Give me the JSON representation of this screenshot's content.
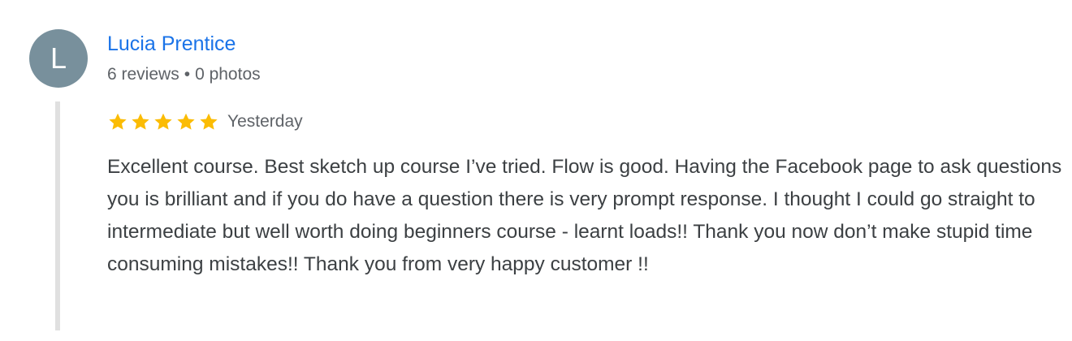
{
  "reviewer": {
    "avatar_letter": "L",
    "avatar_color": "#78909c",
    "name": "Lucia Prentice",
    "reviews_count": "6 reviews",
    "separator": "•",
    "photos_count": "0 photos",
    "name_color": "#1a73e8"
  },
  "review": {
    "rating": 5,
    "max_rating": 5,
    "star_color": "#fbbc04",
    "date": "Yesterday",
    "text": "Excellent course. Best sketch up course I’ve tried. Flow is good. Having the Facebook page to ask questions you is brilliant and if you do have a question there is very prompt response. I thought I could go straight to intermediate but well worth doing beginners course - learnt loads!! Thank you now don’t make stupid time consuming mistakes!! Thank you from very happy customer !!"
  }
}
